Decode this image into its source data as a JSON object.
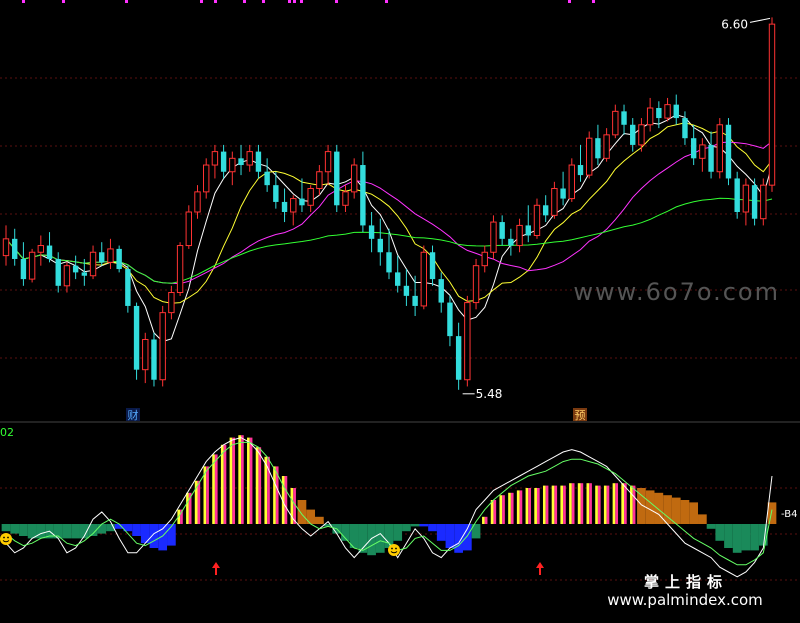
{
  "chart_data": [
    {
      "type": "candlestick",
      "panel": "price",
      "annotations": {
        "high_label": "6.60",
        "low_label": "5.48",
        "marker_cai": "财",
        "marker_yu": "预"
      },
      "candles": [
        [
          5.89,
          5.98,
          5.86,
          5.94
        ],
        [
          5.94,
          5.97,
          5.86,
          5.88
        ],
        [
          5.88,
          5.93,
          5.8,
          5.82
        ],
        [
          5.82,
          5.91,
          5.81,
          5.9
        ],
        [
          5.9,
          5.95,
          5.86,
          5.92
        ],
        [
          5.92,
          5.96,
          5.87,
          5.88
        ],
        [
          5.88,
          5.9,
          5.78,
          5.8
        ],
        [
          5.8,
          5.87,
          5.78,
          5.86
        ],
        [
          5.86,
          5.89,
          5.82,
          5.84
        ],
        [
          5.84,
          5.88,
          5.8,
          5.83
        ],
        [
          5.83,
          5.92,
          5.82,
          5.9
        ],
        [
          5.9,
          5.93,
          5.86,
          5.87
        ],
        [
          5.87,
          5.94,
          5.85,
          5.91
        ],
        [
          5.91,
          5.92,
          5.84,
          5.85
        ],
        [
          5.85,
          5.86,
          5.72,
          5.74
        ],
        [
          5.74,
          5.75,
          5.52,
          5.55
        ],
        [
          5.55,
          5.66,
          5.51,
          5.64
        ],
        [
          5.64,
          5.66,
          5.5,
          5.52
        ],
        [
          5.52,
          5.74,
          5.5,
          5.72
        ],
        [
          5.72,
          5.8,
          5.7,
          5.78
        ],
        [
          5.78,
          5.93,
          5.77,
          5.92
        ],
        [
          5.92,
          6.04,
          5.91,
          6.02
        ],
        [
          6.02,
          6.1,
          6.0,
          6.08
        ],
        [
          6.08,
          6.18,
          6.06,
          6.16
        ],
        [
          6.16,
          6.22,
          6.12,
          6.2
        ],
        [
          6.2,
          6.22,
          6.12,
          6.14
        ],
        [
          6.14,
          6.2,
          6.1,
          6.18
        ],
        [
          6.18,
          6.22,
          6.13,
          6.16
        ],
        [
          6.16,
          6.22,
          6.14,
          6.2
        ],
        [
          6.2,
          6.22,
          6.12,
          6.14
        ],
        [
          6.14,
          6.18,
          6.08,
          6.1
        ],
        [
          6.1,
          6.14,
          6.03,
          6.05
        ],
        [
          6.05,
          6.09,
          5.99,
          6.02
        ],
        [
          6.02,
          6.07,
          5.98,
          6.06
        ],
        [
          6.06,
          6.12,
          6.02,
          6.04
        ],
        [
          6.04,
          6.1,
          6.02,
          6.09
        ],
        [
          6.09,
          6.16,
          6.07,
          6.14
        ],
        [
          6.14,
          6.22,
          6.1,
          6.2
        ],
        [
          6.2,
          6.22,
          6.02,
          6.04
        ],
        [
          6.04,
          6.1,
          6.02,
          6.08
        ],
        [
          6.08,
          6.18,
          6.06,
          6.16
        ],
        [
          6.16,
          6.2,
          5.96,
          5.98
        ],
        [
          5.98,
          6.02,
          5.9,
          5.94
        ],
        [
          5.94,
          6.0,
          5.86,
          5.9
        ],
        [
          5.9,
          5.97,
          5.82,
          5.84
        ],
        [
          5.84,
          5.89,
          5.78,
          5.8
        ],
        [
          5.8,
          5.85,
          5.74,
          5.77
        ],
        [
          5.77,
          5.83,
          5.71,
          5.74
        ],
        [
          5.74,
          5.92,
          5.73,
          5.9
        ],
        [
          5.9,
          5.92,
          5.8,
          5.82
        ],
        [
          5.82,
          5.84,
          5.72,
          5.75
        ],
        [
          5.75,
          5.77,
          5.62,
          5.65
        ],
        [
          5.65,
          5.69,
          5.49,
          5.52
        ],
        [
          5.52,
          5.77,
          5.5,
          5.75
        ],
        [
          5.75,
          5.88,
          5.73,
          5.86
        ],
        [
          5.86,
          5.92,
          5.84,
          5.9
        ],
        [
          5.9,
          6.01,
          5.88,
          5.99
        ],
        [
          5.99,
          6.01,
          5.92,
          5.94
        ],
        [
          5.94,
          5.97,
          5.89,
          5.92
        ],
        [
          5.92,
          6.0,
          5.9,
          5.98
        ],
        [
          5.98,
          6.04,
          5.93,
          5.95
        ],
        [
          5.95,
          6.06,
          5.94,
          6.04
        ],
        [
          6.04,
          6.07,
          5.99,
          6.01
        ],
        [
          6.01,
          6.11,
          6.0,
          6.09
        ],
        [
          6.09,
          6.14,
          6.04,
          6.06
        ],
        [
          6.06,
          6.18,
          6.05,
          6.16
        ],
        [
          6.16,
          6.22,
          6.11,
          6.13
        ],
        [
          6.13,
          6.26,
          6.12,
          6.24
        ],
        [
          6.24,
          6.28,
          6.16,
          6.18
        ],
        [
          6.18,
          6.27,
          6.17,
          6.25
        ],
        [
          6.25,
          6.34,
          6.24,
          6.32
        ],
        [
          6.32,
          6.34,
          6.25,
          6.28
        ],
        [
          6.28,
          6.3,
          6.2,
          6.22
        ],
        [
          6.22,
          6.3,
          6.2,
          6.28
        ],
        [
          6.28,
          6.36,
          6.26,
          6.33
        ],
        [
          6.33,
          6.35,
          6.27,
          6.3
        ],
        [
          6.3,
          6.36,
          6.29,
          6.34
        ],
        [
          6.34,
          6.37,
          6.28,
          6.3
        ],
        [
          6.3,
          6.32,
          6.22,
          6.24
        ],
        [
          6.24,
          6.28,
          6.16,
          6.18
        ],
        [
          6.18,
          6.24,
          6.14,
          6.22
        ],
        [
          6.22,
          6.26,
          6.12,
          6.14
        ],
        [
          6.14,
          6.3,
          6.12,
          6.28
        ],
        [
          6.28,
          6.3,
          6.1,
          6.12
        ],
        [
          6.12,
          6.14,
          6.0,
          6.02
        ],
        [
          6.02,
          6.12,
          5.98,
          6.1
        ],
        [
          6.1,
          6.12,
          5.98,
          6.0
        ],
        [
          6.0,
          6.12,
          5.98,
          6.1
        ],
        [
          6.1,
          6.6,
          6.08,
          6.58
        ]
      ],
      "ma_series": [
        {
          "color": "#ffffff",
          "period": 5
        },
        {
          "color": "#ffff33",
          "period": 10
        },
        {
          "color": "#ff33ff",
          "period": 20
        },
        {
          "color": "#33ff33",
          "period": 60
        }
      ],
      "ylim": [
        5.4,
        6.64
      ]
    },
    {
      "type": "bar+line",
      "panel": "indicator",
      "label": "02",
      "right_label": "-B4",
      "watermark_text": "掌上指标",
      "watermark_url": "www.palmindex.com",
      "site_watermark": "www.6o7o.com",
      "values": [
        -3,
        -4,
        -5,
        -6,
        -6,
        -6,
        -6,
        -6,
        -6,
        -6,
        -5,
        -4,
        -3,
        -2,
        -3,
        -5,
        -8,
        -10,
        -11,
        -9,
        6,
        13,
        18,
        24,
        29,
        33,
        36,
        37,
        36,
        32,
        28,
        24,
        20,
        15,
        10,
        6,
        3,
        -1,
        -4,
        -7,
        -10,
        -12,
        -13,
        -12,
        -10,
        -7,
        -3,
        -1,
        -1,
        -3,
        -7,
        -10,
        -12,
        -11,
        -6,
        3,
        10,
        12,
        13,
        14,
        15,
        15,
        16,
        16,
        16,
        17,
        17,
        17,
        16,
        16,
        17,
        17,
        16,
        15,
        14,
        13,
        12,
        11,
        10,
        9,
        4,
        -2,
        -7,
        -10,
        -12,
        -11,
        -11,
        -9,
        9
      ],
      "white_line": [
        -8,
        -12,
        -10,
        -6,
        -4,
        -3,
        -6,
        -12,
        -10,
        -5,
        2,
        5,
        1,
        -6,
        -12,
        -12,
        -8,
        -4,
        -2,
        2,
        8,
        14,
        20,
        26,
        30,
        33,
        35,
        36,
        34,
        30,
        24,
        16,
        8,
        2,
        -2,
        -5,
        -2,
        1,
        -4,
        -10,
        -14,
        -10,
        -6,
        -4,
        -8,
        -14,
        -8,
        -2,
        -6,
        -12,
        -14,
        -10,
        -8,
        -2,
        6,
        10,
        14,
        16,
        18,
        20,
        22,
        24,
        26,
        28,
        30,
        31,
        30,
        28,
        26,
        24,
        20,
        16,
        12,
        8,
        6,
        4,
        0,
        -4,
        -8,
        -10,
        -12,
        -14,
        -18,
        -20,
        -22,
        -20,
        -16,
        -10,
        20
      ],
      "green_line": [
        -4,
        -7,
        -9,
        -8,
        -6,
        -5,
        -5,
        -8,
        -9,
        -7,
        -4,
        0,
        2,
        0,
        -4,
        -8,
        -9,
        -7,
        -5,
        -1,
        4,
        10,
        16,
        22,
        26,
        30,
        33,
        34,
        34,
        32,
        28,
        22,
        15,
        9,
        4,
        0,
        -2,
        -1,
        -2,
        -6,
        -10,
        -11,
        -9,
        -7,
        -8,
        -11,
        -10,
        -6,
        -5,
        -8,
        -11,
        -11,
        -9,
        -5,
        1,
        6,
        10,
        13,
        16,
        18,
        20,
        21,
        22,
        24,
        26,
        27,
        27,
        26,
        25,
        23,
        21,
        18,
        15,
        12,
        9,
        6,
        3,
        0,
        -3,
        -6,
        -8,
        -10,
        -13,
        -15,
        -17,
        -17,
        -15,
        -12,
        6
      ],
      "ylim": [
        -40,
        40
      ]
    }
  ]
}
